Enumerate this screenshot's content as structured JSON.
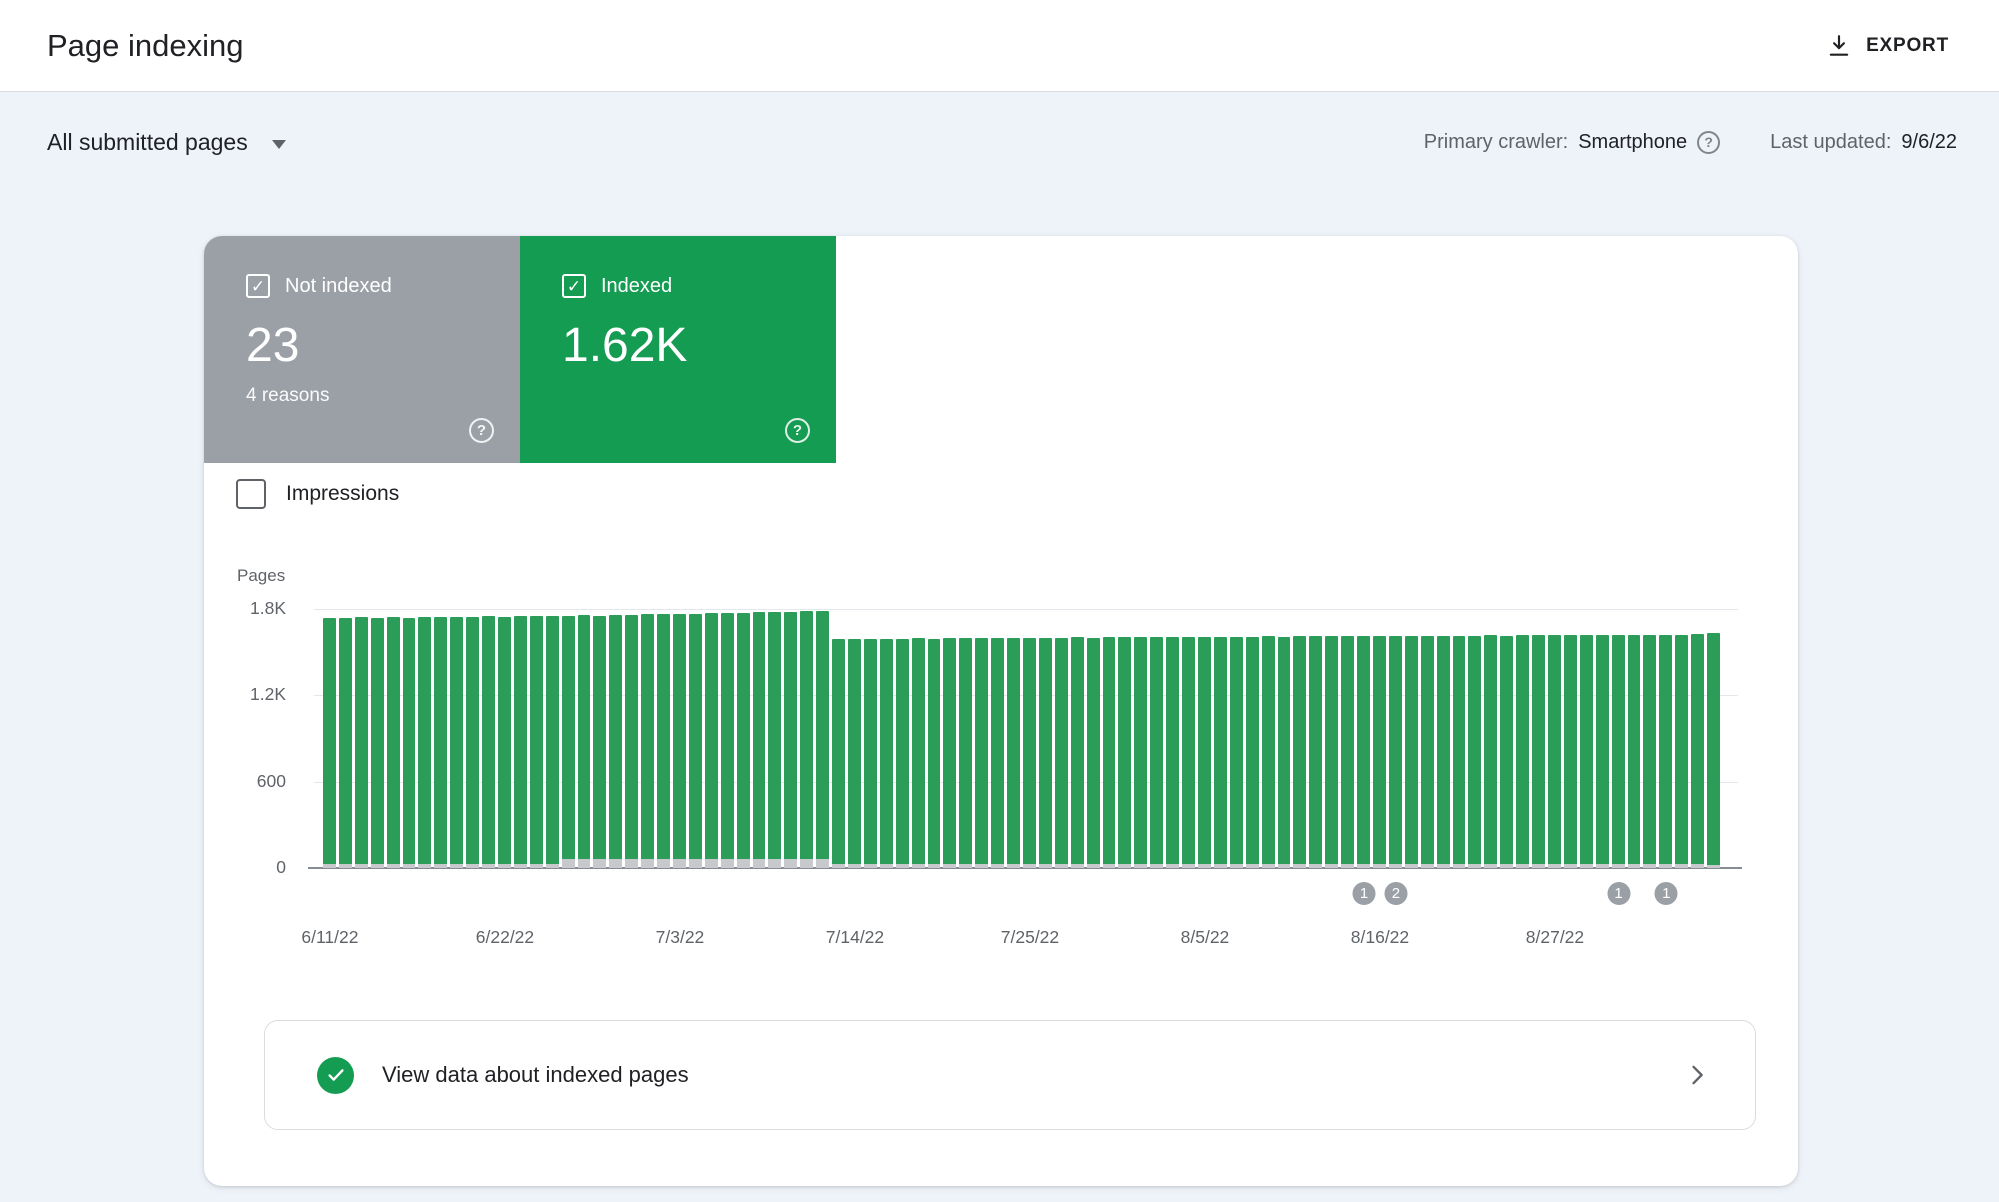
{
  "page": {
    "title": "Page indexing"
  },
  "toolbar": {
    "export_label": "EXPORT"
  },
  "filters": {
    "scope": "All submitted pages",
    "primary_crawler_label": "Primary crawler:",
    "primary_crawler_value": "Smartphone",
    "last_updated_label": "Last updated:",
    "last_updated_value": "9/6/22"
  },
  "stats": {
    "not_indexed": {
      "label": "Not indexed",
      "value": "23",
      "subtext": "4 reasons",
      "checked": true,
      "color": "#9aa0a6"
    },
    "indexed": {
      "label": "Indexed",
      "value": "1.62K",
      "checked": true,
      "color": "#149c53"
    }
  },
  "impressions": {
    "label": "Impressions",
    "checked": false
  },
  "chart_data": {
    "type": "bar",
    "ylabel": "Pages",
    "ylim": [
      0,
      1800
    ],
    "grid": true,
    "date_range": {
      "start": "6/11/22",
      "end": "9/6/22"
    },
    "yticks": [
      {
        "value": 1800,
        "label": "1.8K"
      },
      {
        "value": 1200,
        "label": "1.2K"
      },
      {
        "value": 600,
        "label": "600"
      },
      {
        "value": 0,
        "label": "0"
      }
    ],
    "x_ticks": [
      {
        "index": 0,
        "label": "6/11/22"
      },
      {
        "index": 11,
        "label": "6/22/22"
      },
      {
        "index": 22,
        "label": "7/3/22"
      },
      {
        "index": 33,
        "label": "7/14/22"
      },
      {
        "index": 44,
        "label": "7/25/22"
      },
      {
        "index": 55,
        "label": "8/5/22"
      },
      {
        "index": 66,
        "label": "8/16/22"
      },
      {
        "index": 77,
        "label": "8/27/22"
      }
    ],
    "series": [
      {
        "name": "Indexed",
        "color": "#2b9d58",
        "values": [
          1740,
          1738,
          1742,
          1740,
          1744,
          1741,
          1745,
          1743,
          1747,
          1744,
          1748,
          1746,
          1750,
          1752,
          1749,
          1754,
          1756,
          1753,
          1758,
          1760,
          1762,
          1764,
          1766,
          1768,
          1770,
          1772,
          1774,
          1776,
          1778,
          1780,
          1784,
          1788,
          1590,
          1592,
          1591,
          1594,
          1593,
          1596,
          1595,
          1598,
          1597,
          1600,
          1599,
          1601,
          1600,
          1602,
          1601,
          1603,
          1602,
          1604,
          1603,
          1605,
          1604,
          1606,
          1605,
          1607,
          1606,
          1608,
          1607,
          1609,
          1608,
          1610,
          1609,
          1611,
          1610,
          1612,
          1611,
          1613,
          1612,
          1614,
          1613,
          1615,
          1614,
          1616,
          1615,
          1617,
          1616,
          1618,
          1617,
          1619,
          1618,
          1620,
          1619,
          1621,
          1620,
          1622,
          1624,
          1630
        ]
      },
      {
        "name": "Not indexed",
        "color": "#c7c9cc",
        "values": [
          30,
          30,
          30,
          30,
          30,
          30,
          30,
          30,
          30,
          30,
          30,
          30,
          30,
          30,
          30,
          62,
          62,
          62,
          62,
          62,
          62,
          62,
          62,
          62,
          62,
          62,
          62,
          62,
          62,
          62,
          62,
          62,
          26,
          26,
          26,
          26,
          26,
          26,
          26,
          26,
          26,
          26,
          26,
          26,
          26,
          26,
          26,
          26,
          26,
          26,
          26,
          26,
          26,
          26,
          26,
          26,
          26,
          26,
          26,
          26,
          26,
          26,
          26,
          26,
          26,
          26,
          26,
          26,
          26,
          26,
          26,
          26,
          26,
          26,
          26,
          26,
          26,
          26,
          26,
          26,
          26,
          26,
          26,
          26,
          26,
          26,
          26,
          23
        ]
      }
    ],
    "markers": [
      {
        "index": 65,
        "label": "1"
      },
      {
        "index": 67,
        "label": "2"
      },
      {
        "index": 81,
        "label": "1"
      },
      {
        "index": 84,
        "label": "1"
      }
    ]
  },
  "footer": {
    "label": "View data about indexed pages"
  },
  "icons": {
    "check": "✓",
    "question": "?"
  }
}
